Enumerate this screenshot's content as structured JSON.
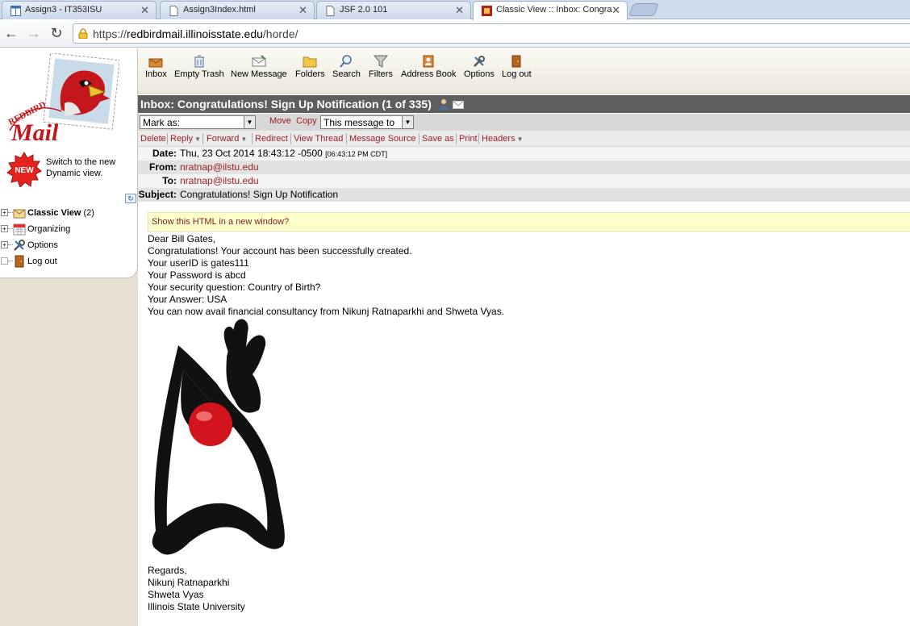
{
  "browser": {
    "tabs": [
      {
        "title": "Assign3 - IT353ISU",
        "active": false
      },
      {
        "title": "Assign3Index.html",
        "active": false
      },
      {
        "title": "JSF 2.0 101",
        "active": false
      },
      {
        "title": "Classic View :: Inbox: Congra",
        "active": true
      }
    ],
    "url_scheme": "https://",
    "url_host": "redbirdmail.illinoisstate.edu",
    "url_path": "/horde/"
  },
  "sidebar": {
    "switch_text": "Switch to the new Dynamic view.",
    "new_badge": "NEW",
    "tree": [
      {
        "label": "Classic View",
        "count": "(2)",
        "bold": true
      },
      {
        "label": "Organizing",
        "count": "",
        "bold": false
      },
      {
        "label": "Options",
        "count": "",
        "bold": false
      },
      {
        "label": "Log out",
        "count": "",
        "bold": false
      }
    ]
  },
  "toolbar": {
    "inbox": "Inbox",
    "empty_trash": "Empty Trash",
    "new_message": "New Message",
    "folders": "Folders",
    "search": "Search",
    "filters": "Filters",
    "address_book": "Address Book",
    "options": "Options",
    "log_out": "Log out"
  },
  "message": {
    "title": "Inbox: Congratulations! Sign Up Notification (1 of 335)",
    "mark_as": "Mark as:",
    "move": "Move",
    "copy": "Copy",
    "this_message_to": "This message to",
    "actions": {
      "delete": "Delete",
      "reply": "Reply",
      "forward": "Forward",
      "redirect": "Redirect",
      "view_thread": "View Thread",
      "message_source": "Message Source",
      "save_as": "Save as",
      "print": "Print",
      "headers": "Headers"
    },
    "headers": {
      "date_label": "Date:",
      "date_value": "Thu, 23 Oct 2014 18:43:12 -0500",
      "date_local": "[06:43:12 PM CDT]",
      "from_label": "From:",
      "from_value": "nratnap@ilstu.edu",
      "to_label": "To:",
      "to_value": "nratnap@ilstu.edu",
      "subject_label": "Subject:",
      "subject_value": "Congratulations! Sign Up Notification"
    },
    "html_notice": "Show this HTML in a new window?",
    "body_lines": [
      "Dear Bill Gates,",
      "Congratulations! Your account has been successfully created.",
      "Your userID is gates111",
      "Your Password is abcd",
      "Your security question: Country of Birth?",
      "Your Answer: USA",
      "You can now avail financial consultancy from Nikunj Ratnaparkhi and Shweta Vyas."
    ],
    "signoff_lines": [
      "Regards,",
      "Nikunj Ratnaparkhi",
      "Shweta Vyas",
      "Illinois State University"
    ]
  }
}
